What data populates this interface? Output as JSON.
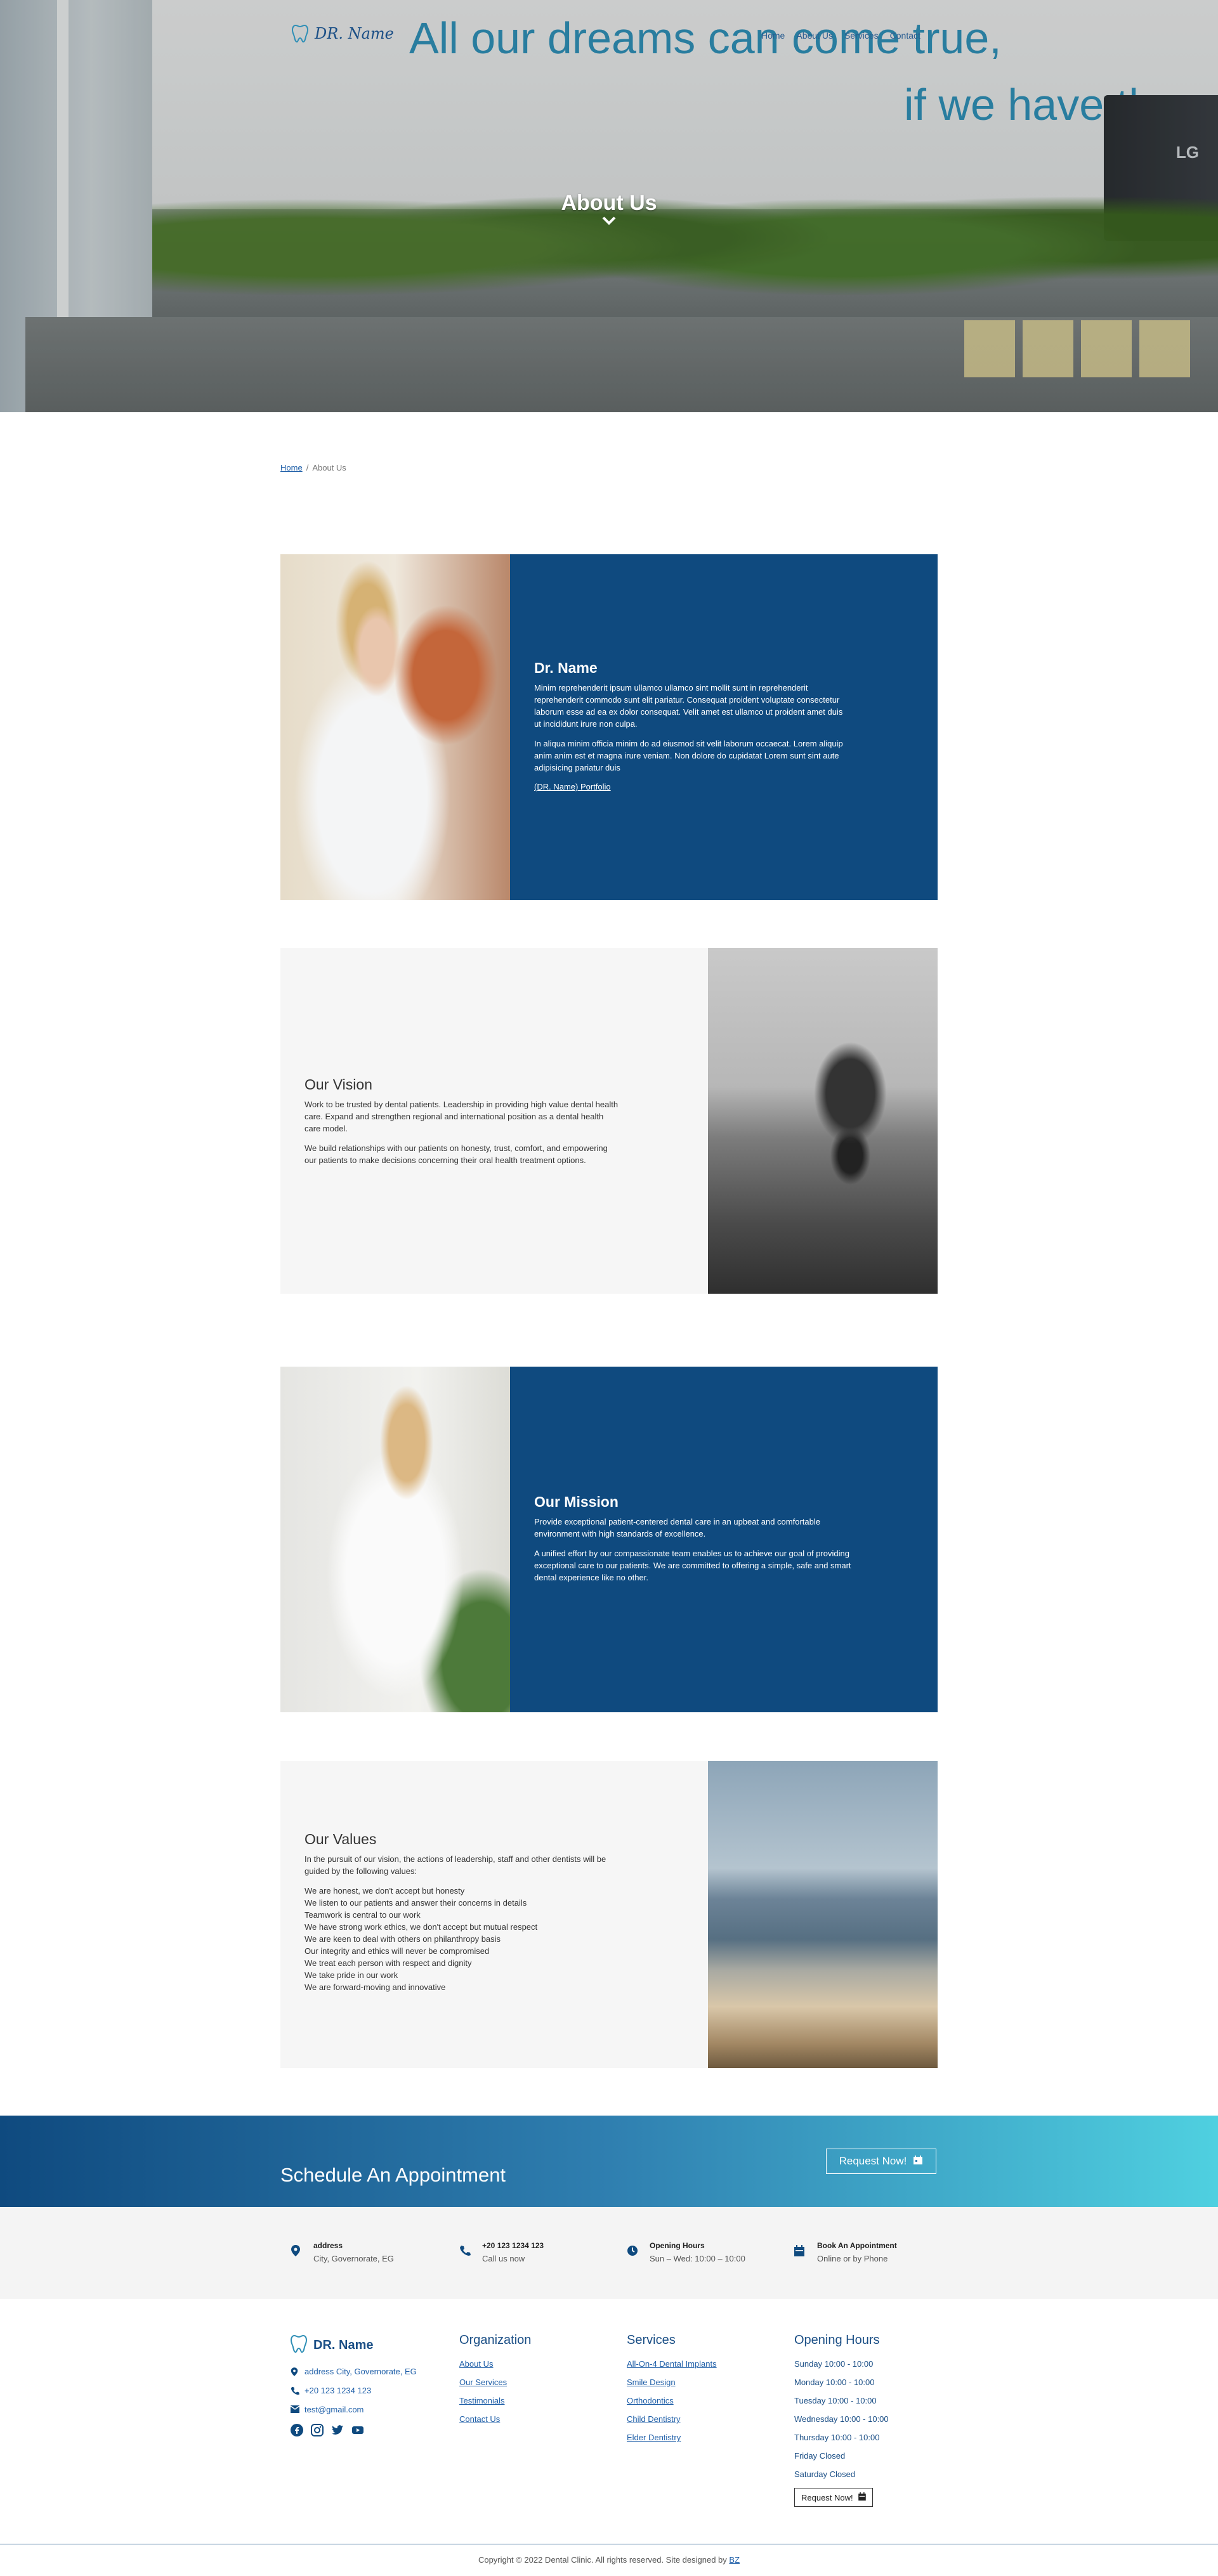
{
  "brand": {
    "name": "DR. Name"
  },
  "hero": {
    "wall_text_line1": "All our dreams can come true,",
    "wall_text_line2": "if we have the",
    "monitor_logo": "LG",
    "title": "About Us"
  },
  "nav": {
    "items": [
      "Home",
      "About Us",
      "Services",
      "Contact"
    ]
  },
  "breadcrumb": {
    "home": "Home",
    "separator": "/",
    "current": "About Us"
  },
  "sections": {
    "doctor": {
      "title": "Dr. Name",
      "p1": "Minim reprehenderit ipsum ullamco ullamco sint mollit sunt in reprehenderit reprehenderit commodo sunt elit pariatur. Consequat proident voluptate consectetur laborum esse ad ea ex dolor consequat. Velit amet est ullamco ut proident amet duis ut incididunt irure non culpa.",
      "p2": "In aliqua minim officia minim do ad eiusmod sit velit laborum occaecat. Lorem aliquip anim anim est et magna irure veniam. Non dolore do cupidatat Lorem sunt sint aute adipisicing pariatur duis",
      "link": "(DR. Name) Portfolio"
    },
    "vision": {
      "title": "Our Vision",
      "p1": "Work to be trusted by dental patients. Leadership in providing high value dental health care. Expand and strengthen regional and international position as a dental health care model.",
      "p2": "We build relationships with our patients on honesty, trust, comfort, and empowering our patients to make decisions concerning their oral health treatment options."
    },
    "mission": {
      "title": "Our Mission",
      "p1": "Provide exceptional patient-centered dental care in an upbeat and comfortable environment with high standards of excellence.",
      "p2": "A unified effort by our compassionate team enables us to achieve our goal of providing exceptional care to our patients. We are committed to offering a simple, safe and smart dental experience like no other."
    },
    "values": {
      "title": "Our Values",
      "intro": "In the pursuit of our vision, the actions of leadership, staff and other dentists will be guided by the following values:",
      "items": [
        "We are honest, we don't accept but honesty",
        "We listen to our patients and answer their concerns in details",
        "Teamwork is central to our work",
        "We have strong work ethics, we don't accept but mutual respect",
        "We are keen to deal with others on philanthropy basis",
        "Our integrity and ethics will never be compromised",
        "We treat each person with respect and dignity",
        "We take pride in our work",
        "We are forward-moving and innovative"
      ]
    }
  },
  "appointment": {
    "title": "Schedule An Appointment",
    "button": "Request Now!"
  },
  "info": {
    "address": {
      "label": "address",
      "value": "City, Governorate, EG"
    },
    "phone": {
      "label": "+20 123 1234 123",
      "value": "Call us now"
    },
    "hours": {
      "label": "Opening Hours",
      "value": "Sun – Wed: 10:00 – 10:00"
    },
    "booking": {
      "label": "Book An Appointment",
      "value": "Online or by Phone"
    }
  },
  "footer": {
    "contact": {
      "address": "address City, Governorate, EG",
      "phone": "+20 123 1234 123",
      "email": "test@gmail.com"
    },
    "organization": {
      "title": "Organization",
      "links": [
        "About Us",
        "Our Services",
        "Testimonials",
        "Contact Us"
      ]
    },
    "services": {
      "title": "Services",
      "links": [
        "All-On-4 Dental Implants",
        "Smile Design",
        "Orthodontics",
        "Child Dentistry",
        "Elder Dentistry"
      ]
    },
    "hours": {
      "title": "Opening Hours",
      "items": [
        "Sunday 10:00 - 10:00",
        "Monday 10:00 - 10:00",
        "Tuesday 10:00 - 10:00",
        "Wednesday 10:00 - 10:00",
        "Thursday 10:00 - 10:00",
        "Friday Closed",
        "Saturday Closed"
      ],
      "button": "Request Now!"
    },
    "copyright": "Copyright © 2022 Dental Clinic. All rights reserved. Site designed by",
    "designer": "BZ"
  },
  "icons": {
    "brand": "tooth-icon",
    "chevron": "chevron-down-icon",
    "calendar": "calendar-icon",
    "map": "map-pin-icon",
    "phone": "phone-icon",
    "clock": "clock-icon",
    "mail": "mail-icon",
    "facebook": "facebook-icon",
    "instagram": "instagram-icon",
    "twitter": "twitter-icon",
    "youtube": "youtube-icon"
  },
  "colors": {
    "primary": "#0f4a7f",
    "accent": "#4fd0e0",
    "link": "#1f5fa8",
    "grey_panel": "#f6f6f6"
  }
}
